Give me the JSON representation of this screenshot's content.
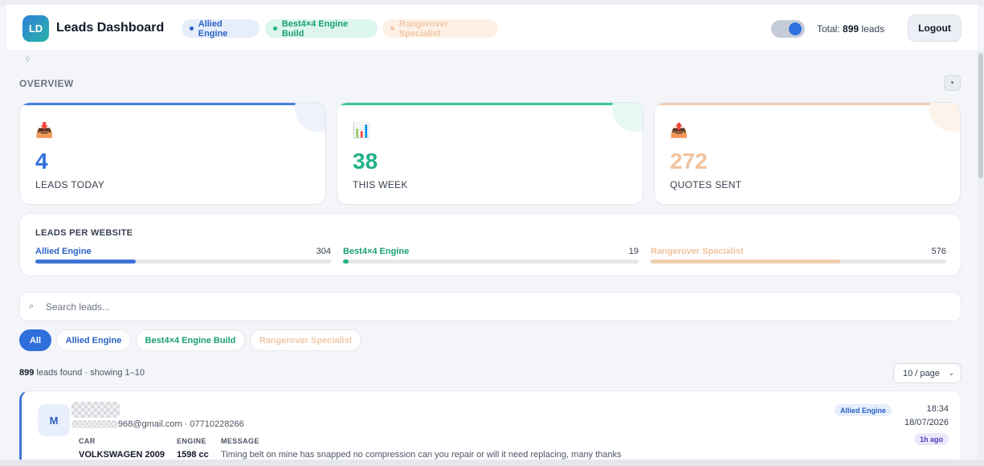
{
  "header": {
    "logo_text": "LD",
    "title": "Leads Dashboard",
    "sites": [
      "Allied Engine",
      "Best4×4 Engine Build",
      "Rangerover Specialist"
    ],
    "total_prefix": "Total:",
    "total_count": "899",
    "total_suffix": "leads",
    "logout_label": "Logout"
  },
  "overview": {
    "title": "OVERVIEW",
    "collapse_icon": "▾",
    "stats": [
      {
        "icon": "📥",
        "value": "4",
        "label": "LEADS TODAY"
      },
      {
        "icon": "📊",
        "value": "38",
        "label": "THIS WEEK"
      },
      {
        "icon": "📤",
        "value": "272",
        "label": "QUOTES SENT"
      }
    ]
  },
  "leads_per_website": {
    "title": "LEADS PER WEBSITE",
    "sites": [
      {
        "name": "Allied Engine",
        "count": "304",
        "fill_fraction": 0.34
      },
      {
        "name": "Best4×4 Engine",
        "count": "19",
        "fill_fraction": 0.02
      },
      {
        "name": "Rangerover Specialist",
        "count": "576",
        "fill_fraction": 0.64
      }
    ]
  },
  "search": {
    "icon": "⌕",
    "placeholder": "Search leads..."
  },
  "filters": [
    "All",
    "Allied Engine",
    "Best4×4 Engine Build",
    "Rangerover Specialist"
  ],
  "results": {
    "count": "899",
    "text": "leads found · showing 1–10",
    "per_page": "10 / page"
  },
  "lead": {
    "initial": "M",
    "email_phone": "968@gmail.com · 07710228266",
    "car_label": "CAR",
    "car_value": "VOLKSWAGEN 2009",
    "engine_label": "ENGINE",
    "engine_value": "1598 cc",
    "message_label": "MESSAGE",
    "message_value": "Timing belt on mine has snapped no compression can you repair or will it need replacing, many thanks",
    "site_badge": "Allied Engine",
    "time": "18:34",
    "date": "18/07/2026",
    "ago": "1h ago"
  },
  "colors": {
    "allied": "#2b62c6",
    "best": "#1a9e76",
    "rangerover": "#f0c7a6",
    "accent": "#2f6fdc"
  }
}
